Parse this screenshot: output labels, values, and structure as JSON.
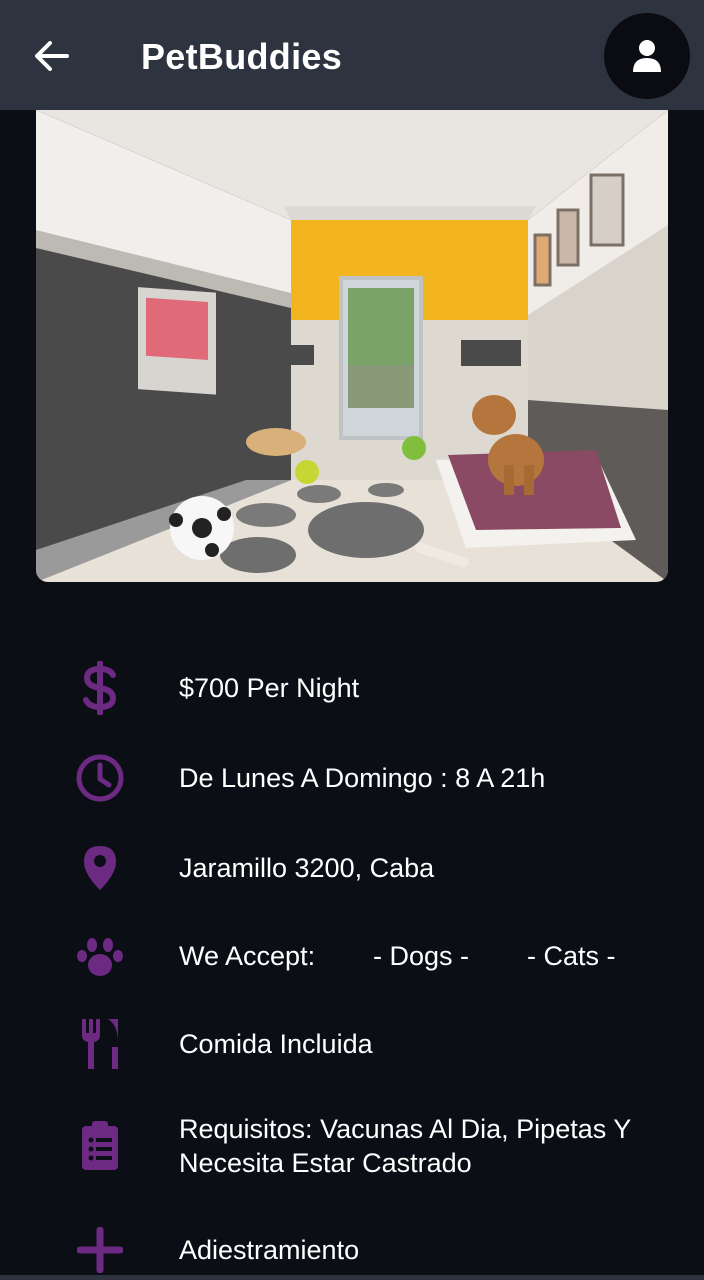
{
  "header": {
    "title": "PetBuddies",
    "back_icon": "arrow-left-icon",
    "profile_icon": "user-icon"
  },
  "hero_image": {
    "description": "pet-hotel-room-photo"
  },
  "colors": {
    "header_bg": "#2d343f",
    "page_bg": "#0c0e16",
    "icon_accent": "#6c2a82",
    "text": "#ffffff"
  },
  "details": {
    "price": {
      "icon": "dollar-icon",
      "text": "$700 Per Night"
    },
    "schedule": {
      "icon": "clock-icon",
      "text": "De Lunes A Domingo : 8 A 21h"
    },
    "location": {
      "icon": "map-pin-icon",
      "text": "Jaramillo 3200, Caba"
    },
    "accept": {
      "icon": "paw-icon",
      "label": "We Accept:",
      "items": [
        "- Dogs -",
        "- Cats -"
      ]
    },
    "food": {
      "icon": "fork-knife-icon",
      "text": "Comida Incluida"
    },
    "requirements": {
      "icon": "clipboard-icon",
      "line1": "Requisitos: Vacunas Al Dia, Pipetas Y",
      "line2": "Necesita Estar Castrado"
    },
    "training": {
      "icon": "plus-icon",
      "text": "Adiestramiento"
    }
  }
}
